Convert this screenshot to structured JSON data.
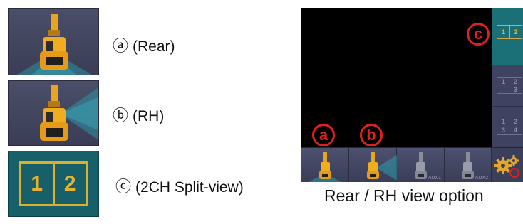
{
  "options": [
    {
      "marker": "ⓐ",
      "label": "(Rear)"
    },
    {
      "marker": "ⓑ",
      "label": "(RH)"
    },
    {
      "marker": "ⓒ",
      "label": "(2CH Split-view)"
    }
  ],
  "split_icon": {
    "cell1": "1",
    "cell2": "2"
  },
  "monitor": {
    "markers": {
      "a": "a",
      "b": "b",
      "c": "c"
    },
    "strip": {
      "two_ch": [
        "1",
        "2"
      ],
      "three_ch": [
        "1",
        "2",
        "",
        "3"
      ],
      "four_ch": [
        "1",
        "2",
        "3",
        "4"
      ]
    },
    "bottom_bar": {
      "aux1_tag": "AUX1",
      "aux2_tag": "AUX2"
    }
  },
  "caption": "Rear / RH view option",
  "colors": {
    "button_bg": "#3c3f5a",
    "split_bg": "#17606a",
    "accent_gold": "#e0ae2e",
    "marker_red": "#e0201c",
    "screen_black": "#000000"
  }
}
